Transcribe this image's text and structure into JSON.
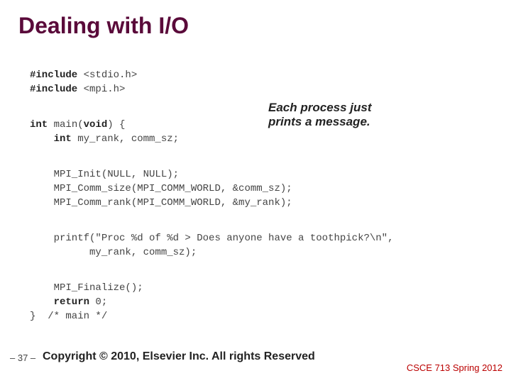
{
  "title": "Dealing with I/O",
  "annotation": "Each process just\nprints a message.",
  "code": {
    "include1_a": "#include",
    "include1_b": " <stdio.h>",
    "include2_a": "#include",
    "include2_b": " <mpi.h>",
    "main_decl_a": "int",
    "main_decl_b": " main(",
    "main_decl_c": "void",
    "main_decl_d": ") {",
    "decl_a": "    int",
    "decl_b": " my_rank, comm_sz;",
    "init": "    MPI_Init(NULL, NULL);",
    "size": "    MPI_Comm_size(MPI_COMM_WORLD, &comm_sz);",
    "rank": "    MPI_Comm_rank(MPI_COMM_WORLD, &my_rank);",
    "printf1": "    printf(\"Proc %d of %d > Does anyone have a toothpick?\\n\",",
    "printf2": "          my_rank, comm_sz);",
    "finalize": "    MPI_Finalize();",
    "return_a": "    return",
    "return_b": " 0;",
    "close": "}  /* main */"
  },
  "footer": {
    "page": "– 37 –",
    "copyright": "Copyright © 2010, Elsevier Inc. All rights Reserved",
    "course": "CSCE 713 Spring 2012"
  }
}
